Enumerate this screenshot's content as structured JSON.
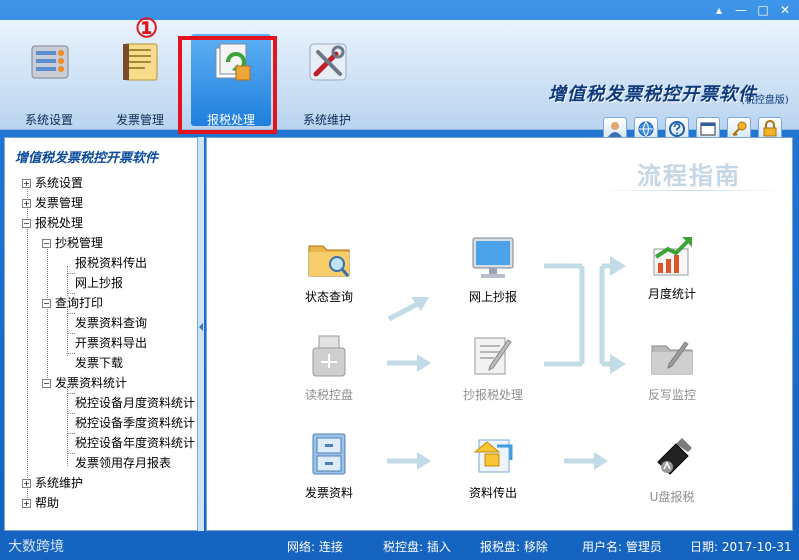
{
  "annotation": "①",
  "window_controls": [
    "▴",
    "—",
    "□",
    "✕"
  ],
  "toolbar": {
    "buttons": [
      {
        "label": "系统设置"
      },
      {
        "label": "发票管理"
      },
      {
        "label": "报税处理"
      },
      {
        "label": "系统维护"
      }
    ],
    "brand": "增值税发票税控开票软件",
    "brand_sub": "(税控盘版)",
    "icons": [
      "user-icon",
      "globe-icon",
      "help-icon",
      "window-icon",
      "key-icon",
      "lock-icon"
    ]
  },
  "tree": {
    "title": "增值税发票税控开票软件",
    "nodes": {
      "n1": "系统设置",
      "n2": "发票管理",
      "n3": "报税处理",
      "n3a": "抄税管理",
      "n3a1": "报税资料传出",
      "n3a2": "网上抄报",
      "n3b": "查询打印",
      "n3b1": "发票资料查询",
      "n3b2": "开票资料导出",
      "n3b3": "发票下载",
      "n3c": "发票资料统计",
      "n3c1": "税控设备月度资料统计",
      "n3c2": "税控设备季度资料统计",
      "n3c3": "税控设备年度资料统计",
      "n3c4": "发票领用存月报表",
      "n4": "系统维护",
      "n5": "帮助"
    },
    "plus": "+",
    "minus": "−"
  },
  "panel": {
    "title": "流程指南",
    "items": {
      "status_query": "状态查询",
      "read_disk": "读税控盘",
      "invoice_data": "发票资料",
      "online_report": "网上抄报",
      "copy_tax": "抄报税处理",
      "data_out": "资料传出",
      "monthly_stats": "月度统计",
      "writeback": "反写监控",
      "usb_report": "U盘报税"
    }
  },
  "status": {
    "logo": "大数跨境",
    "network": "网络: 连接",
    "tax_disk": "税控盘: 插入",
    "report_disk": "报税盘: 移除",
    "user": "用户名: 管理员",
    "date": "日期: 2017-10-31"
  }
}
